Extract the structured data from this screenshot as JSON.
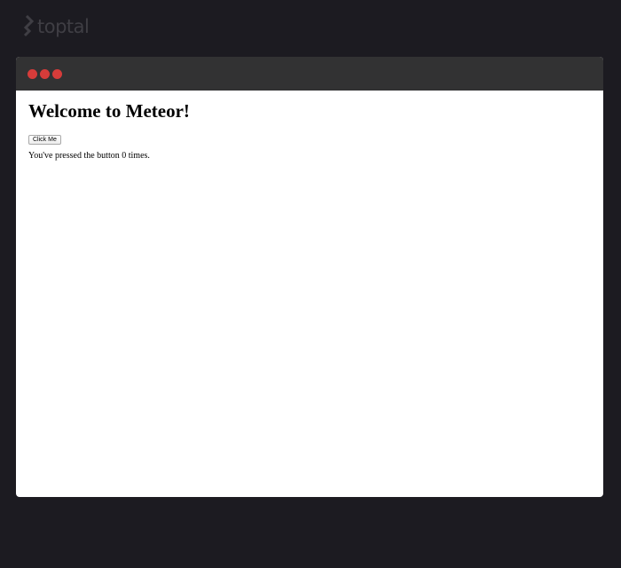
{
  "brand": {
    "name": "toptal",
    "logo_icon": "toptal-logo-icon"
  },
  "colors": {
    "background": "#1c1b21",
    "titlebar": "#323233",
    "window_dots": "#d63c3a",
    "brand_text": "#3f3e44"
  },
  "window": {
    "dots": [
      "window-dot-1",
      "window-dot-2",
      "window-dot-3"
    ]
  },
  "page": {
    "heading": "Welcome to Meteor!",
    "button_label": "Click Me",
    "message_prefix": "You've pressed the button ",
    "count": 0,
    "message_suffix": " times."
  }
}
